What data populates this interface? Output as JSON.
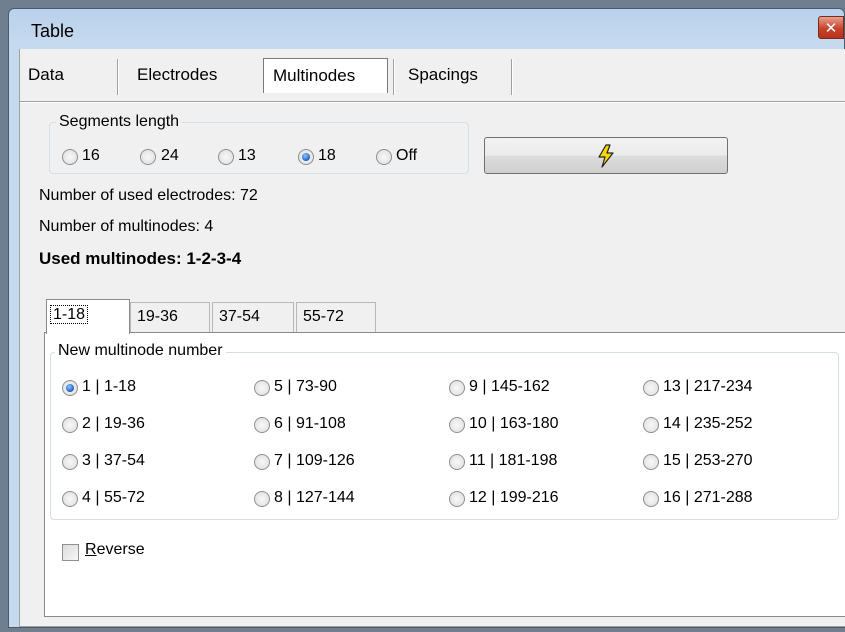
{
  "window": {
    "title": "Table",
    "close_label": "✕"
  },
  "tabs": [
    "Data",
    "Electrodes",
    "Multinodes",
    "Spacings"
  ],
  "selected_tab": "Multinodes",
  "segments": {
    "label": "Segments length",
    "options": [
      "16",
      "24",
      "13",
      "18",
      "Off"
    ],
    "selected": "18"
  },
  "action_button": {
    "icon": "lightning-icon"
  },
  "info": {
    "used_electrodes": "Number of used electrodes: 72",
    "multinodes_count": "Number of multinodes: 4",
    "used_multinodes": "Used multinodes: 1-2-3-4"
  },
  "subtabs": [
    "1-18",
    "19-36",
    "37-54",
    "55-72"
  ],
  "selected_subtab": "1-18",
  "new_multinode": {
    "label": "New multinode number",
    "options": [
      "1 | 1-18",
      "2 | 19-36",
      "3 | 37-54",
      "4 | 55-72",
      "5 | 73-90",
      "6 | 91-108",
      "7 | 109-126",
      "8 | 127-144",
      "9 | 145-162",
      "10 | 163-180",
      "11 | 181-198",
      "12 | 199-216",
      "13 | 217-234",
      "14 | 235-252",
      "15 | 253-270",
      "16 | 271-288"
    ],
    "selected": "1 | 1-18"
  },
  "reverse": {
    "label_first": "R",
    "label_rest": "everse",
    "checked": false
  },
  "colors": {
    "title_bar": "#c5d9ef",
    "close_red": "#c7442a",
    "radio_blue": "#1b5fbf",
    "lightning": "#f5d800"
  }
}
